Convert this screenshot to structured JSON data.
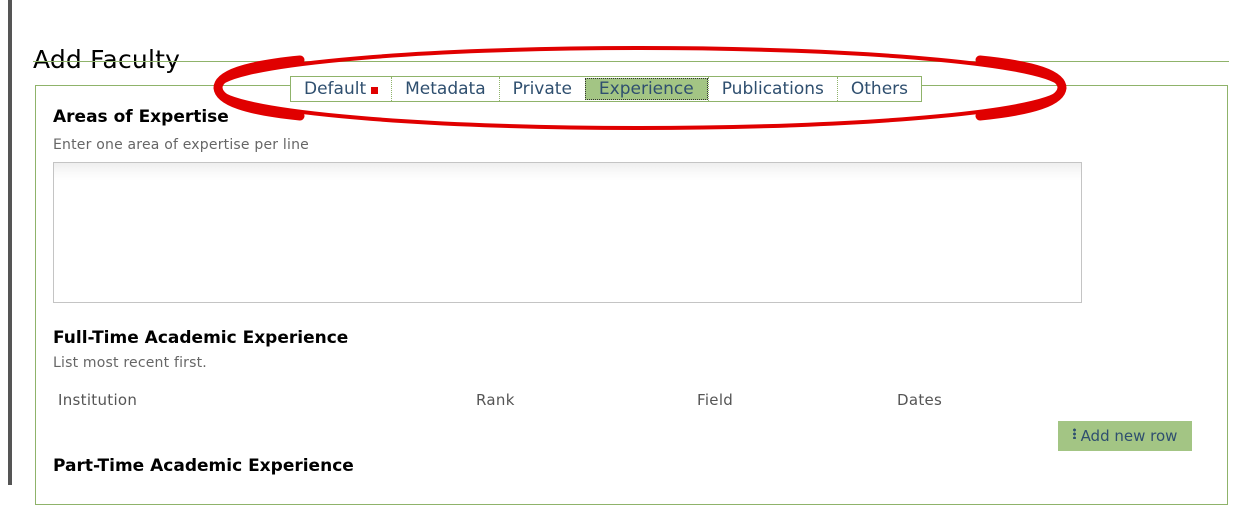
{
  "page": {
    "title": "Add Faculty"
  },
  "tabs": [
    {
      "label": "Default",
      "active": false,
      "required_marker": true
    },
    {
      "label": "Metadata",
      "active": false
    },
    {
      "label": "Private",
      "active": false
    },
    {
      "label": "Experience",
      "active": true
    },
    {
      "label": "Publications",
      "active": false
    },
    {
      "label": "Others",
      "active": false
    }
  ],
  "annotation": {
    "color": "#e00000"
  },
  "expertise": {
    "heading": "Areas of Expertise",
    "help": "Enter one area of expertise per line",
    "value": ""
  },
  "full_time": {
    "heading": "Full-Time Academic Experience",
    "help": "List most recent first.",
    "columns": [
      "Institution",
      "Rank",
      "Field",
      "Dates"
    ],
    "add_row_label": "Add new row",
    "add_row_icon": "grip-icon"
  },
  "part_time": {
    "heading": "Part-Time Academic Experience"
  },
  "colors": {
    "accent": "#8fb36a",
    "active_tab": "#a3c584",
    "link_text": "#2f4f6f"
  }
}
